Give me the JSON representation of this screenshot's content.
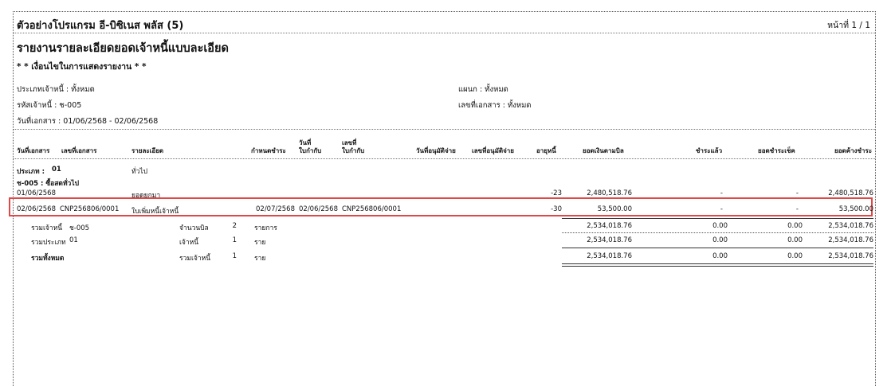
{
  "header": {
    "company": "ตัวอย่างโปรแกรม อี-บิซิเนส พลัส (5)",
    "page_label": "หน้าที่",
    "page_num": "1",
    "page_sep": "/",
    "page_total": "1"
  },
  "report": {
    "title": "รายงานรายละเอียดยอดเจ้าหนี้แบบละเอียด",
    "condition_title": "* * เงื่อนไขในการแสดงรายงาน * *"
  },
  "filters": {
    "creditor_type": "ประเภทเจ้าหนี้ : ทั้งหมด",
    "creditor_code": "รหัสเจ้าหนี้ : ช-005",
    "doc_date": "วันที่เอกสาร : 01/06/2568 - 02/06/2568",
    "department": "แผนก : ทั้งหมด",
    "doc_no": "เลขที่เอกสาร : ทั้งหมด"
  },
  "columns": {
    "doc_date": "วันที่เอกสาร",
    "doc_no": "เลขที่เอกสาร",
    "detail": "รายละเอียด",
    "due_date": "กำหนดชำระ",
    "inv_date_1": "วันที่",
    "inv_date_2": "ใบกำกับ",
    "inv_no_1": "เลขที่",
    "inv_no_2": "ใบกำกับ",
    "approve_date": "วันที่อนุมัติจ่าย",
    "approve_no": "เลขที่อนุมัติจ่าย",
    "age": "อายุหนี้",
    "bill_amount": "ยอดเงินตามบิล",
    "paid": "ชำระแล้ว",
    "net_paid": "ยอดชำระเช็ค",
    "balance": "ยอดค้างชำระ"
  },
  "group": {
    "type_label": "ประเภท :",
    "type_code": "01",
    "type_name": "ทั่วไป",
    "creditor": "ช-005 : ซื้อสดทั่วไป"
  },
  "rows": [
    {
      "doc_date": "01/06/2568",
      "doc_no": "",
      "detail": "ยอดยกมา",
      "due_date": "",
      "inv_date": "",
      "inv_no": "",
      "age": "-23",
      "bill_amount": "2,480,518.76",
      "paid": "-",
      "net_paid": "-",
      "balance": "2,480,518.76"
    },
    {
      "doc_date": "02/06/2568",
      "doc_no": "CNP256806/0001",
      "detail": "ใบเพิ่มหนี้เจ้าหนี้",
      "due_date": "02/07/2568",
      "inv_date": "02/06/2568",
      "inv_no": "CNP256806/0001",
      "age": "-30",
      "bill_amount": "53,500.00",
      "paid": "-",
      "net_paid": "-",
      "balance": "53,500.00"
    }
  ],
  "totals": [
    {
      "label": "รวมเจ้าหนี้",
      "code": "ช-005",
      "count_label": "จำนวนบิล",
      "count": "2",
      "unit": "รายการ",
      "bill_amount": "2,534,018.76",
      "paid": "0.00",
      "net_paid": "0.00",
      "balance": "2,534,018.76"
    },
    {
      "label": "รวมประเภท",
      "code": "01",
      "count_label": "เจ้าหนี้",
      "count": "1",
      "unit": "ราย",
      "bill_amount": "2,534,018.76",
      "paid": "0.00",
      "net_paid": "0.00",
      "balance": "2,534,018.76"
    },
    {
      "label": "รวมทั้งหมด",
      "code": "",
      "count_label": "รวมเจ้าหนี้",
      "count": "1",
      "unit": "ราย",
      "bill_amount": "2,534,018.76",
      "paid": "0.00",
      "net_paid": "0.00",
      "balance": "2,534,018.76"
    }
  ]
}
